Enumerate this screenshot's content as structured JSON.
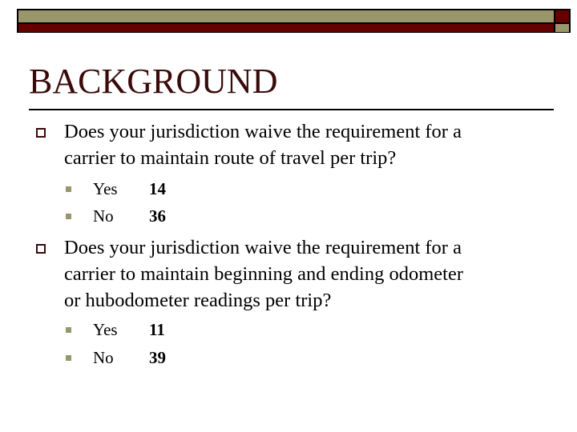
{
  "slide": {
    "title": "BACKGROUND",
    "colors": {
      "olive": "#98966a",
      "dark_red": "#640000",
      "title_color": "#3a0a0a"
    },
    "questions": [
      {
        "bullet_icon": "hollow-square",
        "text": "Does your jurisdiction waive the requirement for a carrier to maintain route of travel per trip?",
        "lines": [
          "Does your jurisdiction waive the requirement for a",
          "carrier to maintain route of travel per trip?"
        ],
        "answers": [
          {
            "bullet_icon": "filled-square",
            "label": "Yes",
            "value": "14"
          },
          {
            "bullet_icon": "filled-square",
            "label": "No",
            "value": "36"
          }
        ]
      },
      {
        "bullet_icon": "hollow-square",
        "text": "Does your jurisdiction waive the requirement for a carrier to maintain beginning and ending odometer or hubodometer readings per trip?",
        "lines": [
          "Does your jurisdiction waive the requirement for a",
          "carrier to maintain beginning and ending odometer",
          "or hubodometer readings per trip?"
        ],
        "answers": [
          {
            "bullet_icon": "filled-square",
            "label": "Yes",
            "value": "11"
          },
          {
            "bullet_icon": "filled-square",
            "label": "No",
            "value": "39"
          }
        ]
      }
    ]
  }
}
